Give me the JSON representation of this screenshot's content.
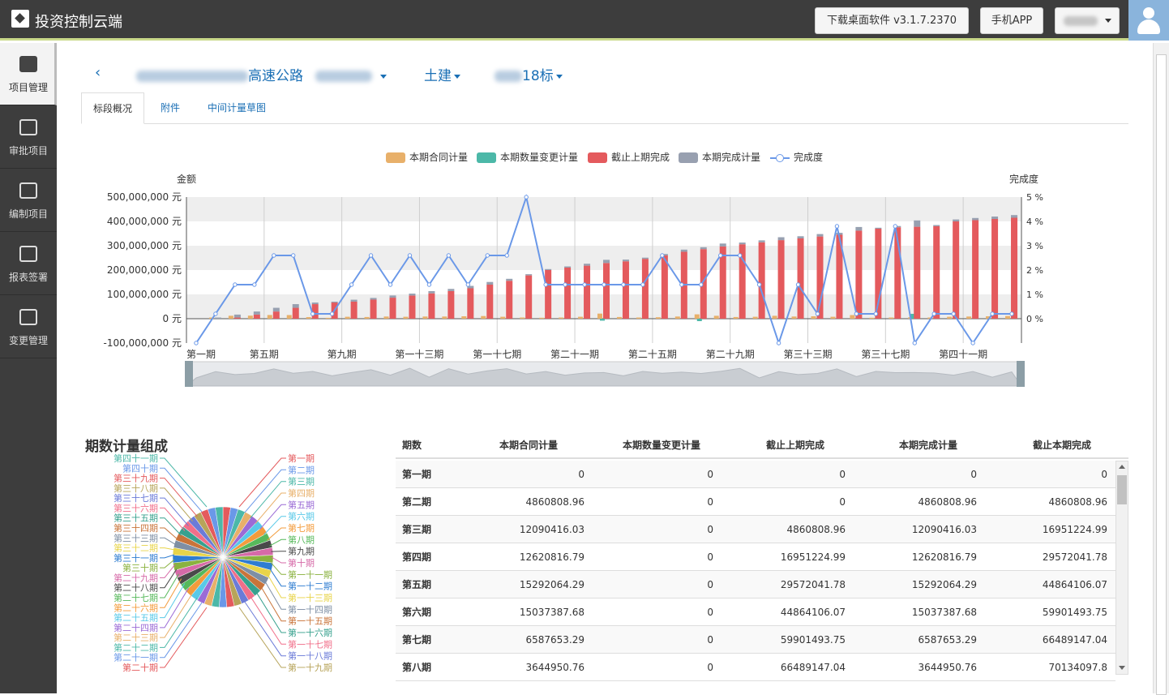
{
  "app": {
    "title": "投资控制云端"
  },
  "topbar": {
    "download_label": "下载桌面软件 v3.1.7.2370",
    "mobile_label": "手机APP"
  },
  "sidebar": {
    "items": [
      {
        "label": "项目管理",
        "icon": "inbox-icon",
        "active": true
      },
      {
        "label": "审批项目",
        "icon": "checklist-icon",
        "active": false
      },
      {
        "label": "编制项目",
        "icon": "upload-tray-icon",
        "active": false
      },
      {
        "label": "报表签署",
        "icon": "printer-icon",
        "active": false
      },
      {
        "label": "变更管理",
        "icon": "clipboard-icon",
        "active": false
      }
    ]
  },
  "breadcrumb": {
    "project_suffix": "高速公路",
    "category": "土建",
    "section_suffix": "18标"
  },
  "tabs": [
    {
      "label": "标段概况",
      "active": true
    },
    {
      "label": "附件",
      "active": false
    },
    {
      "label": "中间计量草图",
      "active": false
    }
  ],
  "chart_data": {
    "type": "bar",
    "ylabel": "金额",
    "y2label": "完成度",
    "ylim": [
      -100000000,
      500000000
    ],
    "yticks": [
      "500,000,000 元",
      "400,000,000 元",
      "300,000,000 元",
      "200,000,000 元",
      "100,000,000 元",
      "0 元",
      "-100,000,000 元"
    ],
    "y2lim": [
      0,
      5
    ],
    "y2ticks": [
      "5 %",
      "4 %",
      "3 %",
      "2 %",
      "1 %",
      "0 %"
    ],
    "x_ticks": [
      "第一期",
      "第五期",
      "第九期",
      "第一十三期",
      "第一十七期",
      "第二十一期",
      "第二十五期",
      "第二十九期",
      "第三十三期",
      "第三十七期",
      "第四十一期"
    ],
    "legend_position": "top",
    "colors": {
      "contract": "#e8b06a",
      "change": "#4cb8a8",
      "prior": "#e45a5d",
      "current": "#98a0b0",
      "progress": "#6a98e8"
    },
    "series": [
      {
        "name": "本期合同计量",
        "values": [
          0,
          4.86,
          12.09,
          12.62,
          15.29,
          15.04,
          6.59,
          3.64,
          8,
          7,
          9,
          8,
          9,
          9,
          10,
          11,
          8,
          5,
          4,
          5,
          8,
          21,
          7,
          5,
          6,
          9,
          18,
          12,
          7,
          8,
          12,
          9,
          10,
          8,
          15,
          4,
          5,
          6,
          5,
          8,
          9,
          10,
          11
        ]
      },
      {
        "name": "本期数量变更计量",
        "values": [
          0,
          0,
          0,
          0,
          0,
          0,
          0,
          0,
          0,
          0,
          0,
          0,
          0,
          0,
          0,
          0,
          0,
          0,
          0,
          0,
          0,
          -8,
          0,
          0,
          0,
          0,
          -10,
          0,
          0,
          0,
          0,
          0,
          0,
          0,
          0,
          0,
          0,
          20,
          0,
          0,
          0,
          0,
          0
        ]
      },
      {
        "name": "截止上期完成",
        "values": [
          0,
          0,
          4.86,
          16.95,
          29.57,
          44.86,
          59.9,
          66.49,
          70.13,
          78.4,
          86.5,
          95.2,
          104.3,
          113.5,
          125,
          140,
          156,
          178,
          200,
          210,
          218,
          229,
          236,
          246,
          260,
          275,
          286,
          297,
          306,
          314,
          323,
          330,
          338,
          345,
          362,
          370,
          376,
          378,
          380,
          400,
          405,
          410,
          415
        ]
      },
      {
        "name": "本期完成计量",
        "values": [
          0,
          4.86,
          12.09,
          12.62,
          15.29,
          15.04,
          6.59,
          3.64,
          8,
          7,
          9,
          8,
          9,
          9,
          10,
          11,
          8,
          5,
          4,
          5,
          8,
          13,
          7,
          5,
          6,
          9,
          8,
          12,
          7,
          8,
          12,
          9,
          10,
          8,
          15,
          4,
          5,
          26,
          5,
          8,
          9,
          10,
          11
        ]
      },
      {
        "name": "完成度",
        "axis": "right",
        "values": [
          0,
          1,
          2,
          2,
          3,
          3,
          1,
          1,
          2,
          3,
          2,
          3,
          2,
          3,
          2,
          3,
          3,
          5,
          2,
          2,
          2,
          2,
          2,
          2,
          3,
          2,
          2,
          3,
          3,
          2,
          0,
          2,
          1,
          4,
          1,
          1,
          4,
          0,
          1,
          1,
          0,
          1,
          1
        ]
      }
    ]
  },
  "pie": {
    "title": "期数计量组成",
    "left_labels": [
      "第四十一期",
      "第四十期",
      "第三十九期",
      "第三十八期",
      "第三十七期",
      "第三十六期",
      "第三十五期",
      "第三十四期",
      "第三十三期",
      "第三十二期",
      "第三十一期",
      "第三十期",
      "第二十九期",
      "第二十八期",
      "第二十七期",
      "第二十六期",
      "第二十五期",
      "第二十四期",
      "第二十三期",
      "第二十二期",
      "第二十一期",
      "第二十期"
    ],
    "right_labels": [
      "第一期",
      "第二期",
      "第三期",
      "第四期",
      "第五期",
      "第六期",
      "第七期",
      "第八期",
      "第九期",
      "第十期",
      "第一十一期",
      "第一十二期",
      "第一十三期",
      "第一十四期",
      "第一十五期",
      "第一十六期",
      "第一十七期",
      "第一十八期",
      "第一十九期"
    ]
  },
  "table": {
    "headers": [
      "期数",
      "本期合同计量",
      "本期数量变更计量",
      "截止上期完成",
      "本期完成计量",
      "截止本期完成"
    ],
    "rows": [
      [
        "第一期",
        "0",
        "0",
        "0",
        "0",
        "0"
      ],
      [
        "第二期",
        "4860808.96",
        "0",
        "0",
        "4860808.96",
        "4860808.96"
      ],
      [
        "第三期",
        "12090416.03",
        "0",
        "4860808.96",
        "12090416.03",
        "16951224.99"
      ],
      [
        "第四期",
        "12620816.79",
        "0",
        "16951224.99",
        "12620816.79",
        "29572041.78"
      ],
      [
        "第五期",
        "15292064.29",
        "0",
        "29572041.78",
        "15292064.29",
        "44864106.07"
      ],
      [
        "第六期",
        "15037387.68",
        "0",
        "44864106.07",
        "15037387.68",
        "59901493.75"
      ],
      [
        "第七期",
        "6587653.29",
        "0",
        "59901493.75",
        "6587653.29",
        "66489147.04"
      ],
      [
        "第八期",
        "3644950.76",
        "0",
        "66489147.04",
        "3644950.76",
        "70134097.8"
      ]
    ]
  }
}
